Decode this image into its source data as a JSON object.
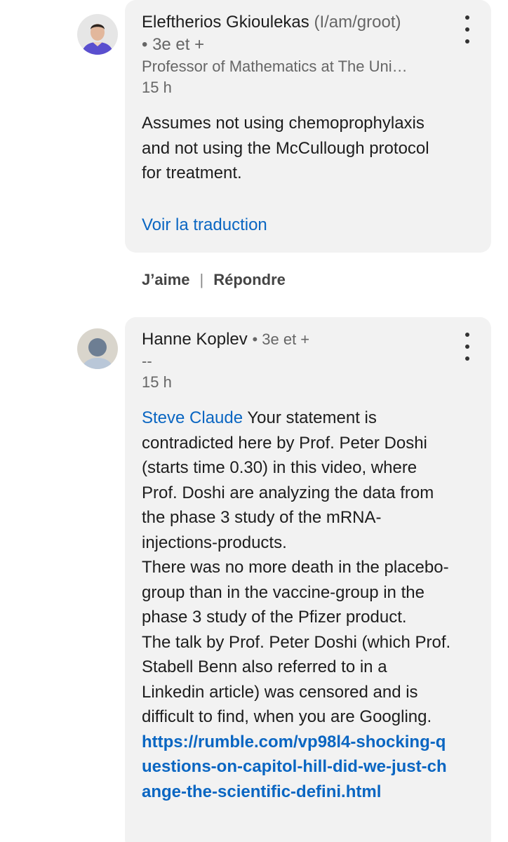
{
  "comments": [
    {
      "author": "Eleftherios Gkioulekas",
      "pronoun": "(I/am/groot)",
      "degree": "• 3e et +",
      "headline": "Professor of Mathematics at The Uni…",
      "time": "15 h",
      "body": "Assumes not using chemoprophylaxis and not using the McCullough protocol for treatment.",
      "translate": "Voir la traduction",
      "like": "J’aime",
      "separator": "|",
      "reply": "Répondre"
    },
    {
      "author": "Hanne Koplev",
      "degree": "• 3e et +",
      "headline": "--",
      "time": "15 h",
      "mention": "Steve Claude",
      "body": " Your statement is contradicted here by Prof. Peter Doshi (starts time 0.30) in this video, where Prof. Doshi are analyzing the data from the phase 3 study of the mRNA-injections-products.\nThere was no more death in the placebo-group than in the vaccine-group in the phase 3 study of the Pfizer product.\nThe talk by Prof. Peter Doshi (which Prof. Stabell Benn also referred to in a Linkedin article) was censored and is difficult to find, when you are Googling.\n",
      "link": "https://rumble.com/vp98l4-shocking-questions-on-capitol-hill-did-we-just-change-the-scientific-defini.html"
    }
  ],
  "icons": {
    "more": "more-vertical-icon",
    "avatar_default": "default-avatar-icon"
  },
  "colors": {
    "link": "#0a66c2",
    "bubble": "#f2f2f2",
    "text": "#1d1d1d",
    "muted": "#666666"
  }
}
